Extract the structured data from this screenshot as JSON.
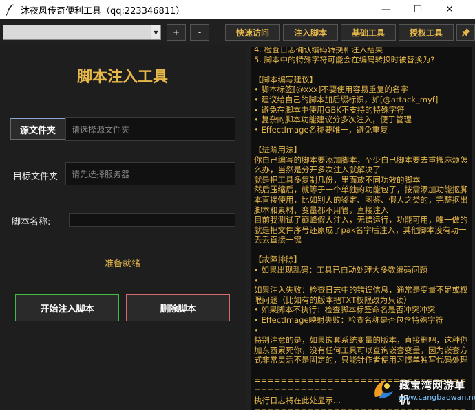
{
  "window": {
    "title": "沐夜风传奇便利工具（qq:223346811）",
    "minimize_glyph": "—",
    "maximize_glyph": "☐",
    "close_glyph": "✕"
  },
  "toolbar": {
    "combo_value": "",
    "plus_label": "+",
    "minus_label": "-",
    "tabs": [
      "快速访问",
      "注入脚本",
      "基础工具",
      "授权工具"
    ],
    "pin_icon": "pin-icon"
  },
  "panel": {
    "heading": "脚本注入工具",
    "source_tab_label": "源文件夹",
    "source_placeholder": "请选择源文件夹",
    "target_label": "目标文件夹",
    "target_placeholder": "请先选择服务器",
    "script_name_label": "脚本名称:",
    "script_name_value": "",
    "status_text": "准备就绪",
    "start_button": "开始注入脚本",
    "delete_button": "删除脚本"
  },
  "log": {
    "lines": [
      "4. 检查日志确认编码转换和注入结果",
      "5. 脚本中的特殊字符可能会在编码转换时被替换为?",
      "",
      "【脚本编写建议】",
      "• 脚本标签[@xxx]不要使用容易重复的名字",
      "• 建议给自己的脚本加后缀标识，如[@attack_myf]",
      "• 避免在脚本中使用GBK不支持的特殊字符",
      "• 复杂的脚本功能建议分多次注入，便于管理",
      "• EffectImage名称要唯一，避免重复",
      "",
      "【进阶用法】",
      "你自己编写的脚本要添加脚本，至少自己脚本要去重搬麻烦怎么办，当然是分开多次注入就解决了",
      "就是把工具多复制几份，里面放不同功效的脚本",
      "然后压缩后，就等于一个单独的功能包了，按需添加功能抠脚本直接使用，比如别人的鉴定、图鉴、假人之类的，完整抠出脚本和素材，变量都不用管，直接注入",
      "目前我测试了巅峰假人注入，无错运行，功能可用，唯一做的就是把文件序号还原成了pak名字后注入，其他脚本没有动一丢丢直接一键",
      "",
      "【故障排除】",
      "• 如果出现乱码：工具已自动处理大多数编码问题",
      "•",
      "如果注入失败：检查日志中的错误信息，通常是变量不足或权限问题（比如有的版本把TXT权限改为只读）",
      "• 如果脚本不执行：检查脚本标签命名是否冲突冲突",
      "• EffectImage映射失败：检查名称是否包含特殊字符",
      "•",
      "特别注意的是，如果嵌套系统变量的版本，直接删吧，这种你加东西累死你，没有任何工具可以查询嵌套变量，因为嵌套方式非常灵活不是固定的，只能针作者使用习惯单独写代码处理",
      "",
      "============================================",
      "执行日志将在此处显示...",
      "============================================"
    ]
  },
  "watermark": {
    "name": "藏宝湾网游单机",
    "url": "www.cangbaowan.net"
  },
  "colors": {
    "accent": "#e6b84a",
    "background": "#1e1e1e",
    "log_background": "#0f0f0f",
    "start_border": "#3fbf3f",
    "delete_border": "#d46a6a"
  }
}
